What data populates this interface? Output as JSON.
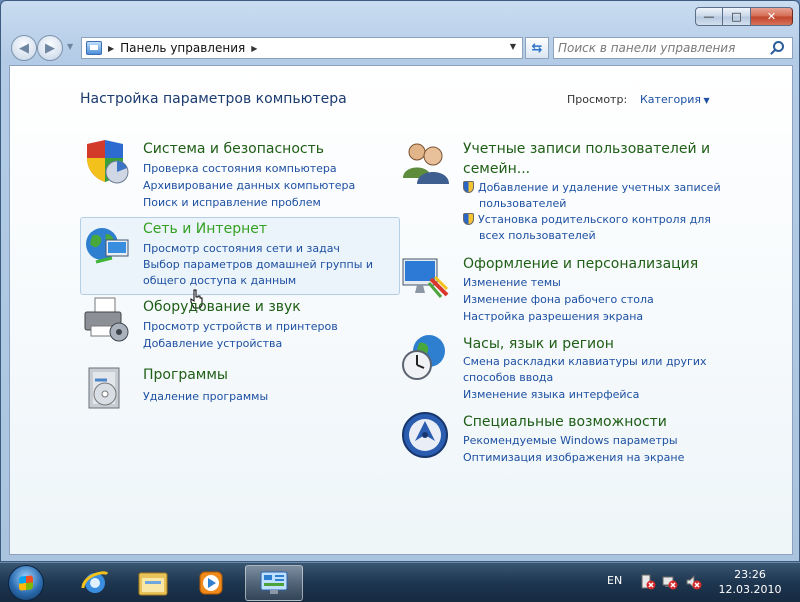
{
  "window": {
    "buttons": {
      "minimize": "—",
      "maximize": "□",
      "close": "✕"
    }
  },
  "address_bar": {
    "path": "Панель управления",
    "search_placeholder": "Поиск в панели управления"
  },
  "header": {
    "title": "Настройка параметров компьютера",
    "view_label": "Просмотр:",
    "view_value": "Категория"
  },
  "categories_left": [
    {
      "title": "Система и безопасность",
      "links": [
        "Проверка состояния компьютера",
        "Архивирование данных компьютера",
        "Поиск и исправление проблем"
      ]
    },
    {
      "title": "Сеть и Интернет",
      "links": [
        "Просмотр состояния сети и задач",
        "Выбор параметров домашней группы и",
        "общего доступа к данным"
      ]
    },
    {
      "title": "Оборудование и звук",
      "links": [
        "Просмотр устройств и принтеров",
        "Добавление устройства"
      ]
    },
    {
      "title": "Программы",
      "links": [
        "Удаление программы"
      ]
    }
  ],
  "categories_right": [
    {
      "title_line1": "Учетные записи пользователей и",
      "title_line2": "семейн...",
      "links": [
        {
          "line1": "Добавление и удаление учетных записей",
          "line2": "пользователей"
        },
        {
          "line1": "Установка родительского контроля для",
          "line2": "всех пользователей"
        }
      ]
    },
    {
      "title": "Оформление и персонализация",
      "links": [
        "Изменение темы",
        "Изменение фона рабочего стола",
        "Настройка разрешения экрана"
      ]
    },
    {
      "title": "Часы, язык и регион",
      "links": [
        "Смена раскладки клавиатуры или других",
        "способов ввода",
        "Изменение языка интерфейса"
      ]
    },
    {
      "title": "Специальные возможности",
      "links": [
        "Рекомендуемые Windows параметры",
        "Оптимизация изображения на экране"
      ]
    }
  ],
  "taskbar": {
    "language": "EN",
    "time": "23:26",
    "date": "12.03.2010"
  }
}
